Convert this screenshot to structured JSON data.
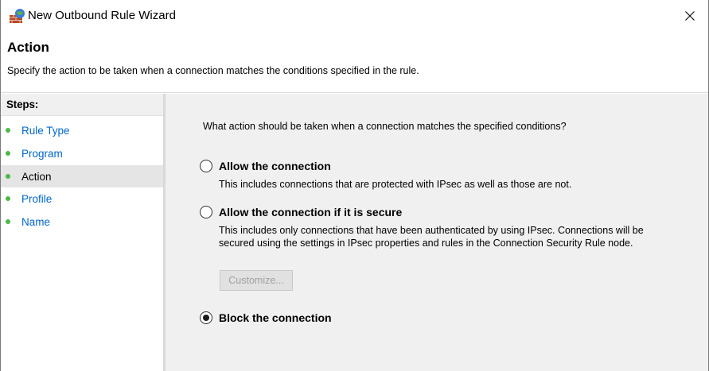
{
  "window": {
    "title": "New Outbound Rule Wizard",
    "app_icon": "firewall-icon",
    "close_icon": "close-icon"
  },
  "header": {
    "title": "Action",
    "subtitle": "Specify the action to be taken when a connection matches the conditions specified in the rule."
  },
  "steps": {
    "heading": "Steps:",
    "items": [
      {
        "label": "Rule Type",
        "active": false
      },
      {
        "label": "Program",
        "active": false
      },
      {
        "label": "Action",
        "active": true
      },
      {
        "label": "Profile",
        "active": false
      },
      {
        "label": "Name",
        "active": false
      }
    ]
  },
  "main": {
    "question": "What action should be taken when a connection matches the specified conditions?",
    "options": [
      {
        "label": "Allow the connection",
        "description": "This includes connections that are protected with IPsec as well as those are not.",
        "selected": false
      },
      {
        "label": "Allow the connection if it is secure",
        "description": "This includes only connections that have been authenticated by using IPsec.  Connections will be secured using the settings in IPsec properties and rules in the Connection Security Rule node.",
        "selected": false
      },
      {
        "label": "Block the connection",
        "description": "",
        "selected": true
      }
    ],
    "customize_label": "Customize..."
  },
  "colors": {
    "step_dot": "#4cb848",
    "step_link": "#0066cc",
    "panel_bg": "#f0f0f0"
  }
}
